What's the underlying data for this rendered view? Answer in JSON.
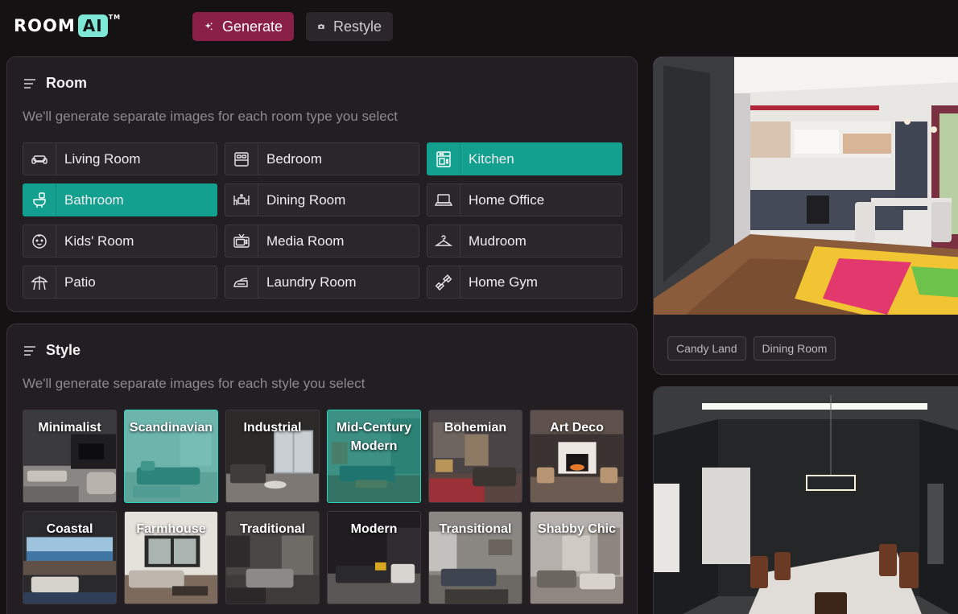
{
  "header": {
    "logo_room": "ROOM",
    "logo_ai": "AI",
    "logo_tm": "TM",
    "generate_label": "Generate",
    "restyle_label": "Restyle"
  },
  "room_section": {
    "title": "Room",
    "subtitle": "We'll generate separate images for each room type you select",
    "items": [
      {
        "label": "Living Room",
        "icon": "sofa-icon",
        "selected": false
      },
      {
        "label": "Bedroom",
        "icon": "bed-icon",
        "selected": false
      },
      {
        "label": "Kitchen",
        "icon": "oven-icon",
        "selected": true
      },
      {
        "label": "Bathroom",
        "icon": "toilet-icon",
        "selected": true
      },
      {
        "label": "Dining Room",
        "icon": "dining-icon",
        "selected": false
      },
      {
        "label": "Home Office",
        "icon": "laptop-icon",
        "selected": false
      },
      {
        "label": "Kids' Room",
        "icon": "baby-face-icon",
        "selected": false
      },
      {
        "label": "Media Room",
        "icon": "tv-icon",
        "selected": false
      },
      {
        "label": "Mudroom",
        "icon": "hanger-icon",
        "selected": false
      },
      {
        "label": "Patio",
        "icon": "umbrella-icon",
        "selected": false
      },
      {
        "label": "Laundry Room",
        "icon": "iron-icon",
        "selected": false
      },
      {
        "label": "Home Gym",
        "icon": "dumbbell-icon",
        "selected": false
      }
    ]
  },
  "style_section": {
    "title": "Style",
    "subtitle": "We'll generate separate images for each style you select",
    "items": [
      {
        "label": "Minimalist",
        "selected": false
      },
      {
        "label": "Scandinavian",
        "selected": true
      },
      {
        "label": "Industrial",
        "selected": false
      },
      {
        "label": "Mid-Century Modern",
        "selected": true
      },
      {
        "label": "Bohemian",
        "selected": false
      },
      {
        "label": "Art Deco",
        "selected": false
      },
      {
        "label": "Coastal",
        "selected": false
      },
      {
        "label": "Farmhouse",
        "selected": false
      },
      {
        "label": "Traditional",
        "selected": false
      },
      {
        "label": "Modern",
        "selected": false
      },
      {
        "label": "Transitional",
        "selected": false
      },
      {
        "label": "Shabby Chic",
        "selected": false
      }
    ]
  },
  "results": {
    "first": {
      "tags": [
        "Candy Land",
        "Dining Room"
      ]
    }
  },
  "colors": {
    "accent_teal": "#13a08f",
    "generate_bg": "#8a1f46",
    "panel_bg": "#221e21"
  }
}
